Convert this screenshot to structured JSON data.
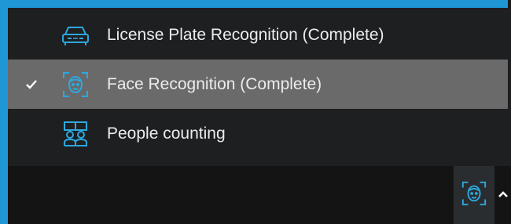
{
  "menu": {
    "items": [
      {
        "label": "License Plate Recognition (Complete)",
        "icon": "car-icon",
        "selected": false
      },
      {
        "label": "Face Recognition (Complete)",
        "icon": "face-recognition-icon",
        "selected": true
      },
      {
        "label": "People counting",
        "icon": "people-counting-icon",
        "selected": false
      }
    ]
  },
  "toolbar": {
    "active_icon": "face-recognition-icon",
    "toggle_icon": "chevron-up-icon"
  },
  "colors": {
    "accent_blue": "#1f97d6",
    "icon_cyan": "#2da8df",
    "menu_bg": "#1d1f21",
    "selected_bg": "#6a6a6a",
    "text": "#ececec"
  }
}
